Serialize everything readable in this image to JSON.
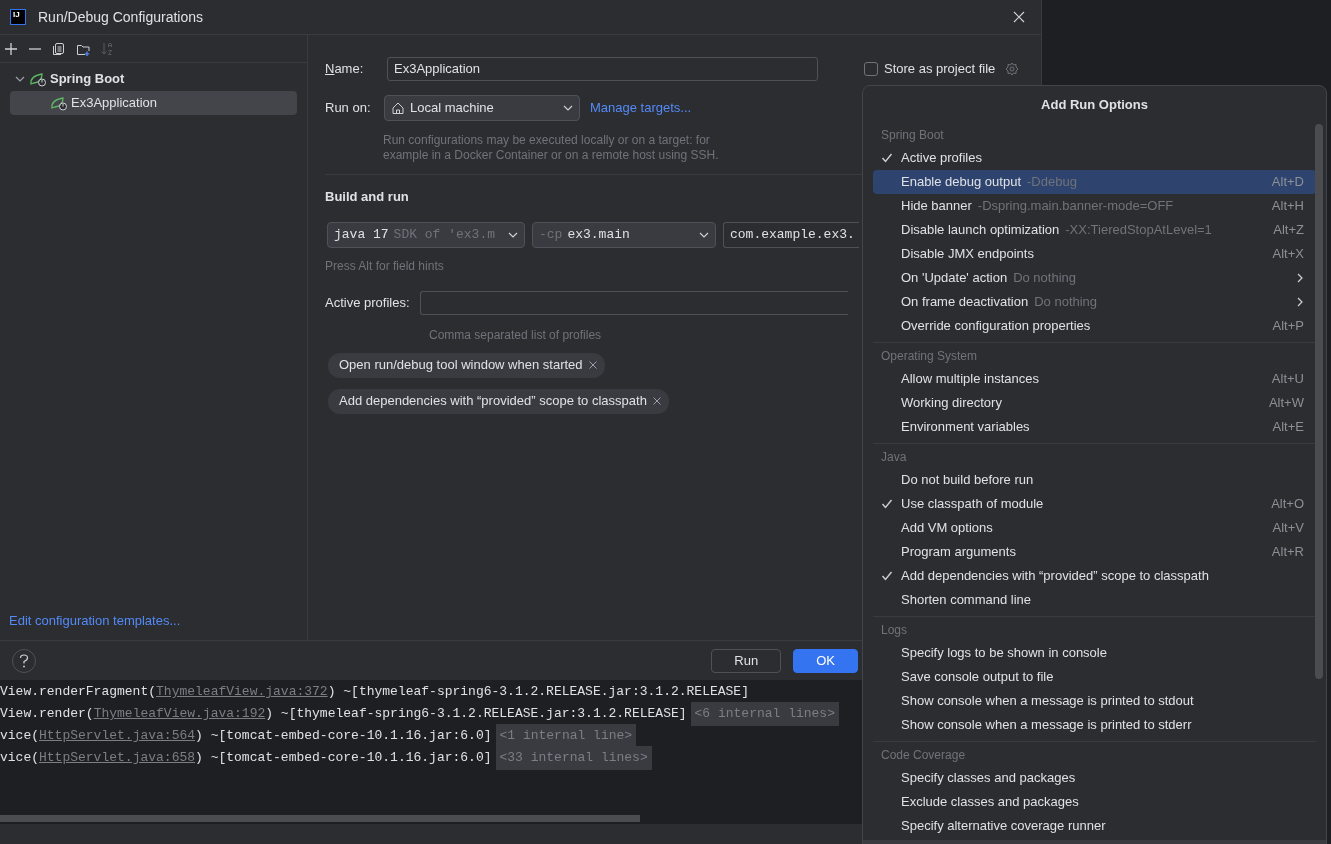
{
  "window": {
    "logo": "IJ",
    "title": "Run/Debug Configurations"
  },
  "toolbar_buttons": [
    {
      "kind": "add",
      "disabled": false
    },
    {
      "kind": "remove",
      "disabled": false
    },
    {
      "kind": "copy",
      "disabled": false
    },
    {
      "kind": "folder",
      "disabled": false
    },
    {
      "kind": "sort",
      "disabled": true
    }
  ],
  "tree": [
    {
      "label": "Spring Boot",
      "expanded": true,
      "selected": false,
      "children": [
        {
          "label": "Ex3Application",
          "selected": true
        }
      ]
    }
  ],
  "edit_templates_link": "Edit configuration templates...",
  "form": {
    "name_label": "Name:",
    "name_value": "Ex3Application",
    "store_label": "Store as project file",
    "store_checked": false,
    "run_on_label": "Run on:",
    "run_on_value": "Local machine",
    "manage_targets": "Manage targets...",
    "run_on_help": "Run configurations may be executed locally or on a target: for example in a Docker Container or on a remote host using SSH.",
    "section": "Build and run",
    "jre": {
      "value": "java 17",
      "hint": "SDK of 'ex3.m"
    },
    "cp": {
      "prefix": "-cp",
      "value": "ex3.main"
    },
    "main_class": "com.example.ex3.",
    "field_hint": "Press Alt for field hints",
    "profiles_label": "Active profiles:",
    "profiles_help": "Comma separated list of profiles",
    "chips": [
      "Open run/debug tool window when started",
      "Add dependencies with “provided” scope to classpath"
    ]
  },
  "buttons": [
    {
      "label": "Run",
      "primary": false
    },
    {
      "label": "OK",
      "primary": true
    }
  ],
  "console": [
    [
      {
        "kind": "plain",
        "text": "View.renderFragment("
      },
      {
        "kind": "link",
        "text": "ThymeleafView.java:372"
      },
      {
        "kind": "plain",
        "text": ") ~[thymeleaf-spring6-3.1.2.RELEASE.jar:3.1.2.RELEASE]"
      }
    ],
    [
      {
        "kind": "plain",
        "text": "View.render("
      },
      {
        "kind": "link",
        "text": "ThymeleafView.java:192"
      },
      {
        "kind": "plain",
        "text": ") ~[thymeleaf-spring6-3.1.2.RELEASE.jar:3.1.2.RELEASE]"
      },
      {
        "kind": "fold",
        "text": "<6 internal lines>"
      }
    ],
    [
      {
        "kind": "plain",
        "text": "vice("
      },
      {
        "kind": "link",
        "text": "HttpServlet.java:564"
      },
      {
        "kind": "plain",
        "text": ") ~[tomcat-embed-core-10.1.16.jar:6.0]"
      },
      {
        "kind": "fold",
        "text": "<1 internal line>"
      }
    ],
    [
      {
        "kind": "plain",
        "text": "vice("
      },
      {
        "kind": "link",
        "text": "HttpServlet.java:658"
      },
      {
        "kind": "plain",
        "text": ") ~[tomcat-embed-core-10.1.16.jar:6.0]"
      },
      {
        "kind": "fold",
        "text": "<33 internal lines>"
      }
    ]
  ],
  "popup": {
    "title": "Add Run Options",
    "sections": [
      {
        "title": "Spring Boot",
        "items": [
          {
            "label": "Active profiles",
            "checked": true,
            "selected": false
          },
          {
            "label": "Enable debug output",
            "hint": "-Ddebug",
            "shortcut": "Alt+D",
            "checked": false,
            "selected": true
          },
          {
            "label": "Hide banner",
            "hint": "-Dspring.main.banner-mode=OFF",
            "shortcut": "Alt+H",
            "checked": false,
            "selected": false
          },
          {
            "label": "Disable launch optimization",
            "hint": "-XX:TieredStopAtLevel=1",
            "shortcut": "Alt+Z",
            "checked": false,
            "selected": false
          },
          {
            "label": "Disable JMX endpoints",
            "shortcut": "Alt+X",
            "checked": false,
            "selected": false
          },
          {
            "label": "On 'Update' action",
            "hint": "Do nothing",
            "submenu": true,
            "checked": false,
            "selected": false
          },
          {
            "label": "On frame deactivation",
            "hint": "Do nothing",
            "submenu": true,
            "checked": false,
            "selected": false
          },
          {
            "label": "Override configuration properties",
            "shortcut": "Alt+P",
            "checked": false,
            "selected": false
          }
        ]
      },
      {
        "title": "Operating System",
        "items": [
          {
            "label": "Allow multiple instances",
            "shortcut": "Alt+U",
            "checked": false,
            "selected": false
          },
          {
            "label": "Working directory",
            "shortcut": "Alt+W",
            "checked": false,
            "selected": false
          },
          {
            "label": "Environment variables",
            "shortcut": "Alt+E",
            "checked": false,
            "selected": false
          }
        ]
      },
      {
        "title": "Java",
        "items": [
          {
            "label": "Do not build before run",
            "checked": false,
            "selected": false
          },
          {
            "label": "Use classpath of module",
            "shortcut": "Alt+O",
            "checked": true,
            "selected": false
          },
          {
            "label": "Add VM options",
            "shortcut": "Alt+V",
            "checked": false,
            "selected": false
          },
          {
            "label": "Program arguments",
            "shortcut": "Alt+R",
            "checked": false,
            "selected": false
          },
          {
            "label": "Add dependencies with “provided” scope to classpath",
            "checked": true,
            "selected": false
          },
          {
            "label": "Shorten command line",
            "checked": false,
            "selected": false
          }
        ]
      },
      {
        "title": "Logs",
        "items": [
          {
            "label": "Specify logs to be shown in console",
            "checked": false,
            "selected": false
          },
          {
            "label": "Save console output to file",
            "checked": false,
            "selected": false
          },
          {
            "label": "Show console when a message is printed to stdout",
            "checked": false,
            "selected": false
          },
          {
            "label": "Show console when a message is printed to stderr",
            "checked": false,
            "selected": false
          }
        ]
      },
      {
        "title": "Code Coverage",
        "items": [
          {
            "label": "Specify classes and packages",
            "checked": false,
            "selected": false
          },
          {
            "label": "Exclude classes and packages",
            "checked": false,
            "selected": false
          },
          {
            "label": "Specify alternative coverage runner",
            "checked": false,
            "selected": false
          }
        ]
      }
    ]
  }
}
